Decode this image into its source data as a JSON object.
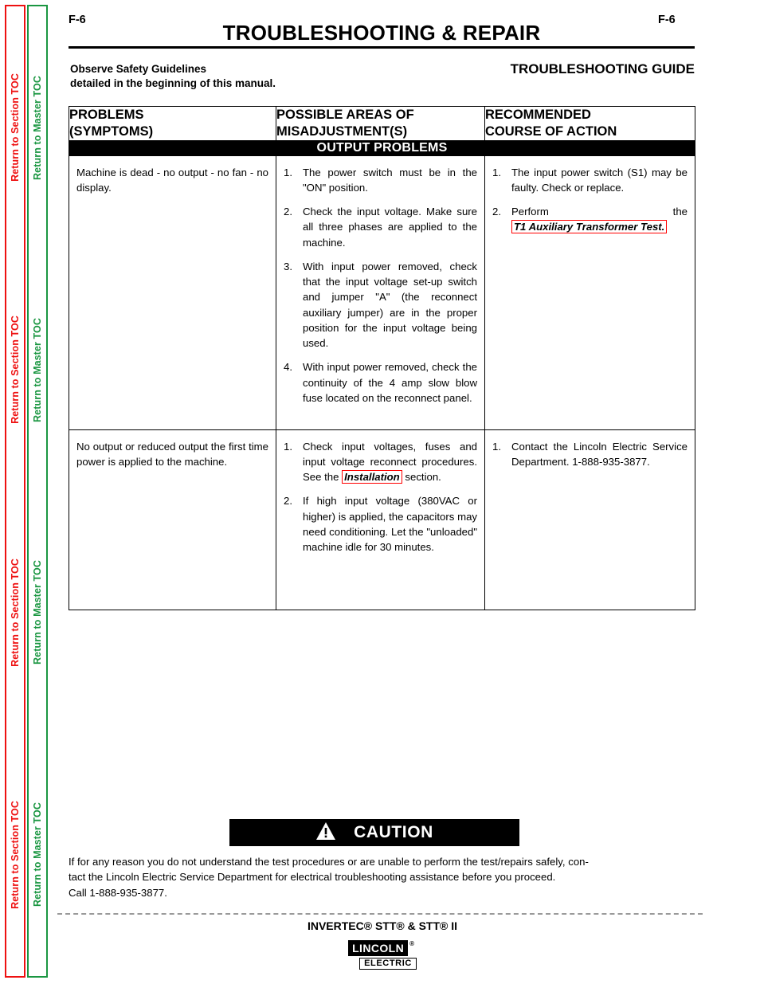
{
  "sidebar": {
    "section_toc": {
      "label": "Return to Section TOC",
      "color": "#ee1111",
      "repeat": 4
    },
    "master_toc": {
      "label": "Return to Master TOC",
      "color": "#1a9641",
      "repeat": 4
    }
  },
  "header": {
    "page_number_left": "F-6",
    "page_number_right": "F-6",
    "title": "TROUBLESHOOTING & REPAIR",
    "observe_line1": "Observe Safety Guidelines",
    "observe_line2": "detailed in the beginning of this manual.",
    "guide_label": "TROUBLESHOOTING GUIDE"
  },
  "table": {
    "columns": [
      {
        "line1": "PROBLEMS",
        "line2": "(SYMPTOMS)"
      },
      {
        "line1": "POSSIBLE AREAS OF",
        "line2": "MISADJUSTMENT(S)"
      },
      {
        "line1": "RECOMMENDED",
        "line2": "COURSE OF ACTION"
      }
    ],
    "band_label": "OUTPUT PROBLEMS",
    "rows": [
      {
        "symptom": "Machine is dead - no output - no fan - no display.",
        "possible_areas": [
          {
            "num": "1.",
            "text": "The power switch must be in the \"ON\" position."
          },
          {
            "num": "2.",
            "text": "Check the input voltage.  Make sure all three phases are applied to the machine."
          },
          {
            "num": "3.",
            "text": "With input power removed, check that the input voltage set-up switch and jumper \"A\" (the reconnect auxiliary jumper) are in the proper position for the input voltage being used."
          },
          {
            "num": "4.",
            "text": "With input power removed, check the continuity of the 4 amp slow blow fuse located on the reconnect panel."
          }
        ],
        "recommended": [
          {
            "num": "1.",
            "before": "The input power switch (S1) may be faulty.  Check or replace.",
            "link": "",
            "after": ""
          },
          {
            "num": "2.",
            "before": "Perform the ",
            "link": "T1 Auxiliary Transformer Test.",
            "after": ""
          }
        ]
      },
      {
        "symptom": "No output or reduced output the first time power is applied to the machine.",
        "possible_areas": [
          {
            "num": "1.",
            "before": "Check input voltages, fuses and input voltage reconnect procedures.  See the ",
            "link": "Installation",
            "after": " section."
          },
          {
            "num": "2.",
            "text": "If high input voltage (380VAC or higher) is applied, the capacitors may need conditioning.  Let the \"unloaded\" machine idle for 30 minutes."
          }
        ],
        "recommended": [
          {
            "num": "1.",
            "text": "Contact the Lincoln Electric Service Department. 1-888-935-3877."
          }
        ]
      }
    ]
  },
  "caution": {
    "icon": "warning-triangle-icon",
    "label": "CAUTION",
    "body_line1": "If for any reason you do not understand the test procedures or are unable to perform the test/repairs safely, con-",
    "body_line2": "tact the Lincoln Electric Service Department for electrical troubleshooting assistance before you proceed.",
    "body_line3": "Call 1-888-935-3877."
  },
  "footer": {
    "product": "INVERTEC® STT® & STT® II",
    "logo_name": "LINCOLN",
    "logo_reg": "®",
    "logo_sub": "ELECTRIC"
  },
  "colors": {
    "link_box": "#ff0000",
    "section_toc": "#ee1111",
    "master_toc": "#1a9641",
    "band": "#000000"
  }
}
